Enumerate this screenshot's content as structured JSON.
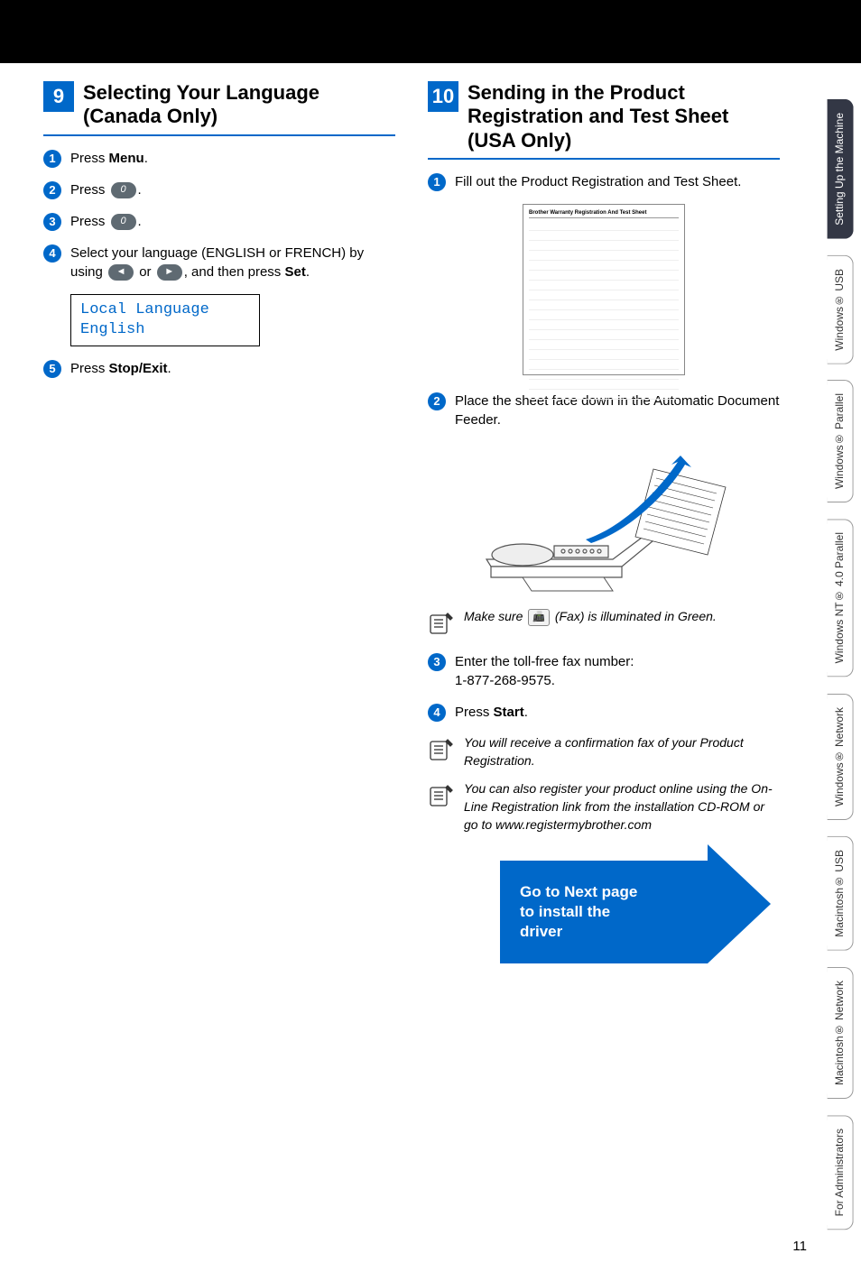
{
  "page_number": "11",
  "section9": {
    "number": "9",
    "title": "Selecting Your Language (Canada Only)",
    "steps": {
      "s1_pre": "Press ",
      "s1_bold": "Menu",
      "s1_post": ".",
      "s2_pre": "Press ",
      "s2_post": ".",
      "s2_key": "0",
      "s3_pre": "Press ",
      "s3_post": ".",
      "s3_key": "0",
      "s4_a": "Select your language (ENGLISH or FRENCH) by using ",
      "s4_b": " or ",
      "s4_c": ", and then press ",
      "s4_bold": "Set",
      "s4_d": ".",
      "s5_pre": "Press ",
      "s5_bold": "Stop/Exit",
      "s5_post": "."
    },
    "lcd": {
      "line1": "Local Language",
      "line2": "English"
    }
  },
  "section10": {
    "number": "10",
    "title": "Sending in the Product Registration and Test Sheet (USA Only)",
    "steps": {
      "s1": "Fill out the Product Registration and Test Sheet.",
      "s2": "Place the sheet face down in the Automatic Document Feeder.",
      "s3_a": "Enter the toll-free fax number:",
      "s3_b": "1-877-268-9575.",
      "s4_pre": "Press ",
      "s4_bold": "Start",
      "s4_post": "."
    },
    "form_header": "Brother Warranty Registration And Test Sheet",
    "note1_a": "Make sure ",
    "note1_b": " (Fax) is illuminated in Green.",
    "note2": "You will receive a confirmation fax of your Product Registration.",
    "note3": "You can also register your product online using the On-Line Registration link from the installation CD-ROM or go to www.registermybrother.com",
    "next_cta": "Go to Next page to install the driver"
  },
  "tabs": {
    "t0": "Setting Up the Machine",
    "t1": "Windows® USB",
    "t2": "Windows® Parallel",
    "t3": "Windows NT® 4.0 Parallel",
    "t4": "Windows® Network",
    "t5": "Macintosh® USB",
    "t6": "Macintosh® Network",
    "t7": "For Administrators"
  }
}
